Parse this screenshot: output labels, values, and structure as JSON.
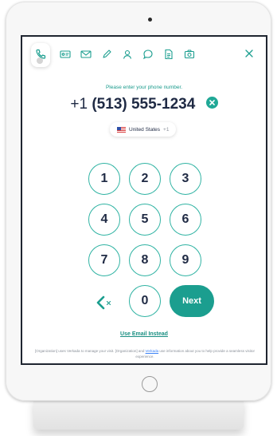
{
  "header": {
    "tabs": [
      {
        "name": "phone-icon",
        "active": true
      },
      {
        "name": "id-card-icon",
        "active": false
      },
      {
        "name": "mail-icon",
        "active": false
      },
      {
        "name": "pen-icon",
        "active": false
      },
      {
        "name": "person-icon",
        "active": false
      },
      {
        "name": "chat-icon",
        "active": false
      },
      {
        "name": "document-icon",
        "active": false
      },
      {
        "name": "camera-icon",
        "active": false
      }
    ],
    "close_icon": "close-icon"
  },
  "prompt": "Please enter your phone number.",
  "phone": {
    "prefix": "+1",
    "number": "(513) 555-1234",
    "clear_icon": "clear-circle-icon"
  },
  "country": {
    "flag": "us-flag-icon",
    "name": "United States",
    "code": "+1"
  },
  "keypad": {
    "keys": [
      "1",
      "2",
      "3",
      "4",
      "5",
      "6",
      "7",
      "8",
      "9",
      "0"
    ],
    "backspace_icon": "backspace-icon",
    "next_label": "Next"
  },
  "email_link": "Use Email Instead",
  "disclaimer": {
    "part1": "[Organization] uses Verkada to manage your visit. [Organization] and ",
    "link": "Verkada",
    "part2": " use information about you to help provide a seamless visitor experience."
  },
  "colors": {
    "accent": "#1b9e8f",
    "text_dark": "#1f2a44",
    "key_border": "#30b3a3"
  }
}
